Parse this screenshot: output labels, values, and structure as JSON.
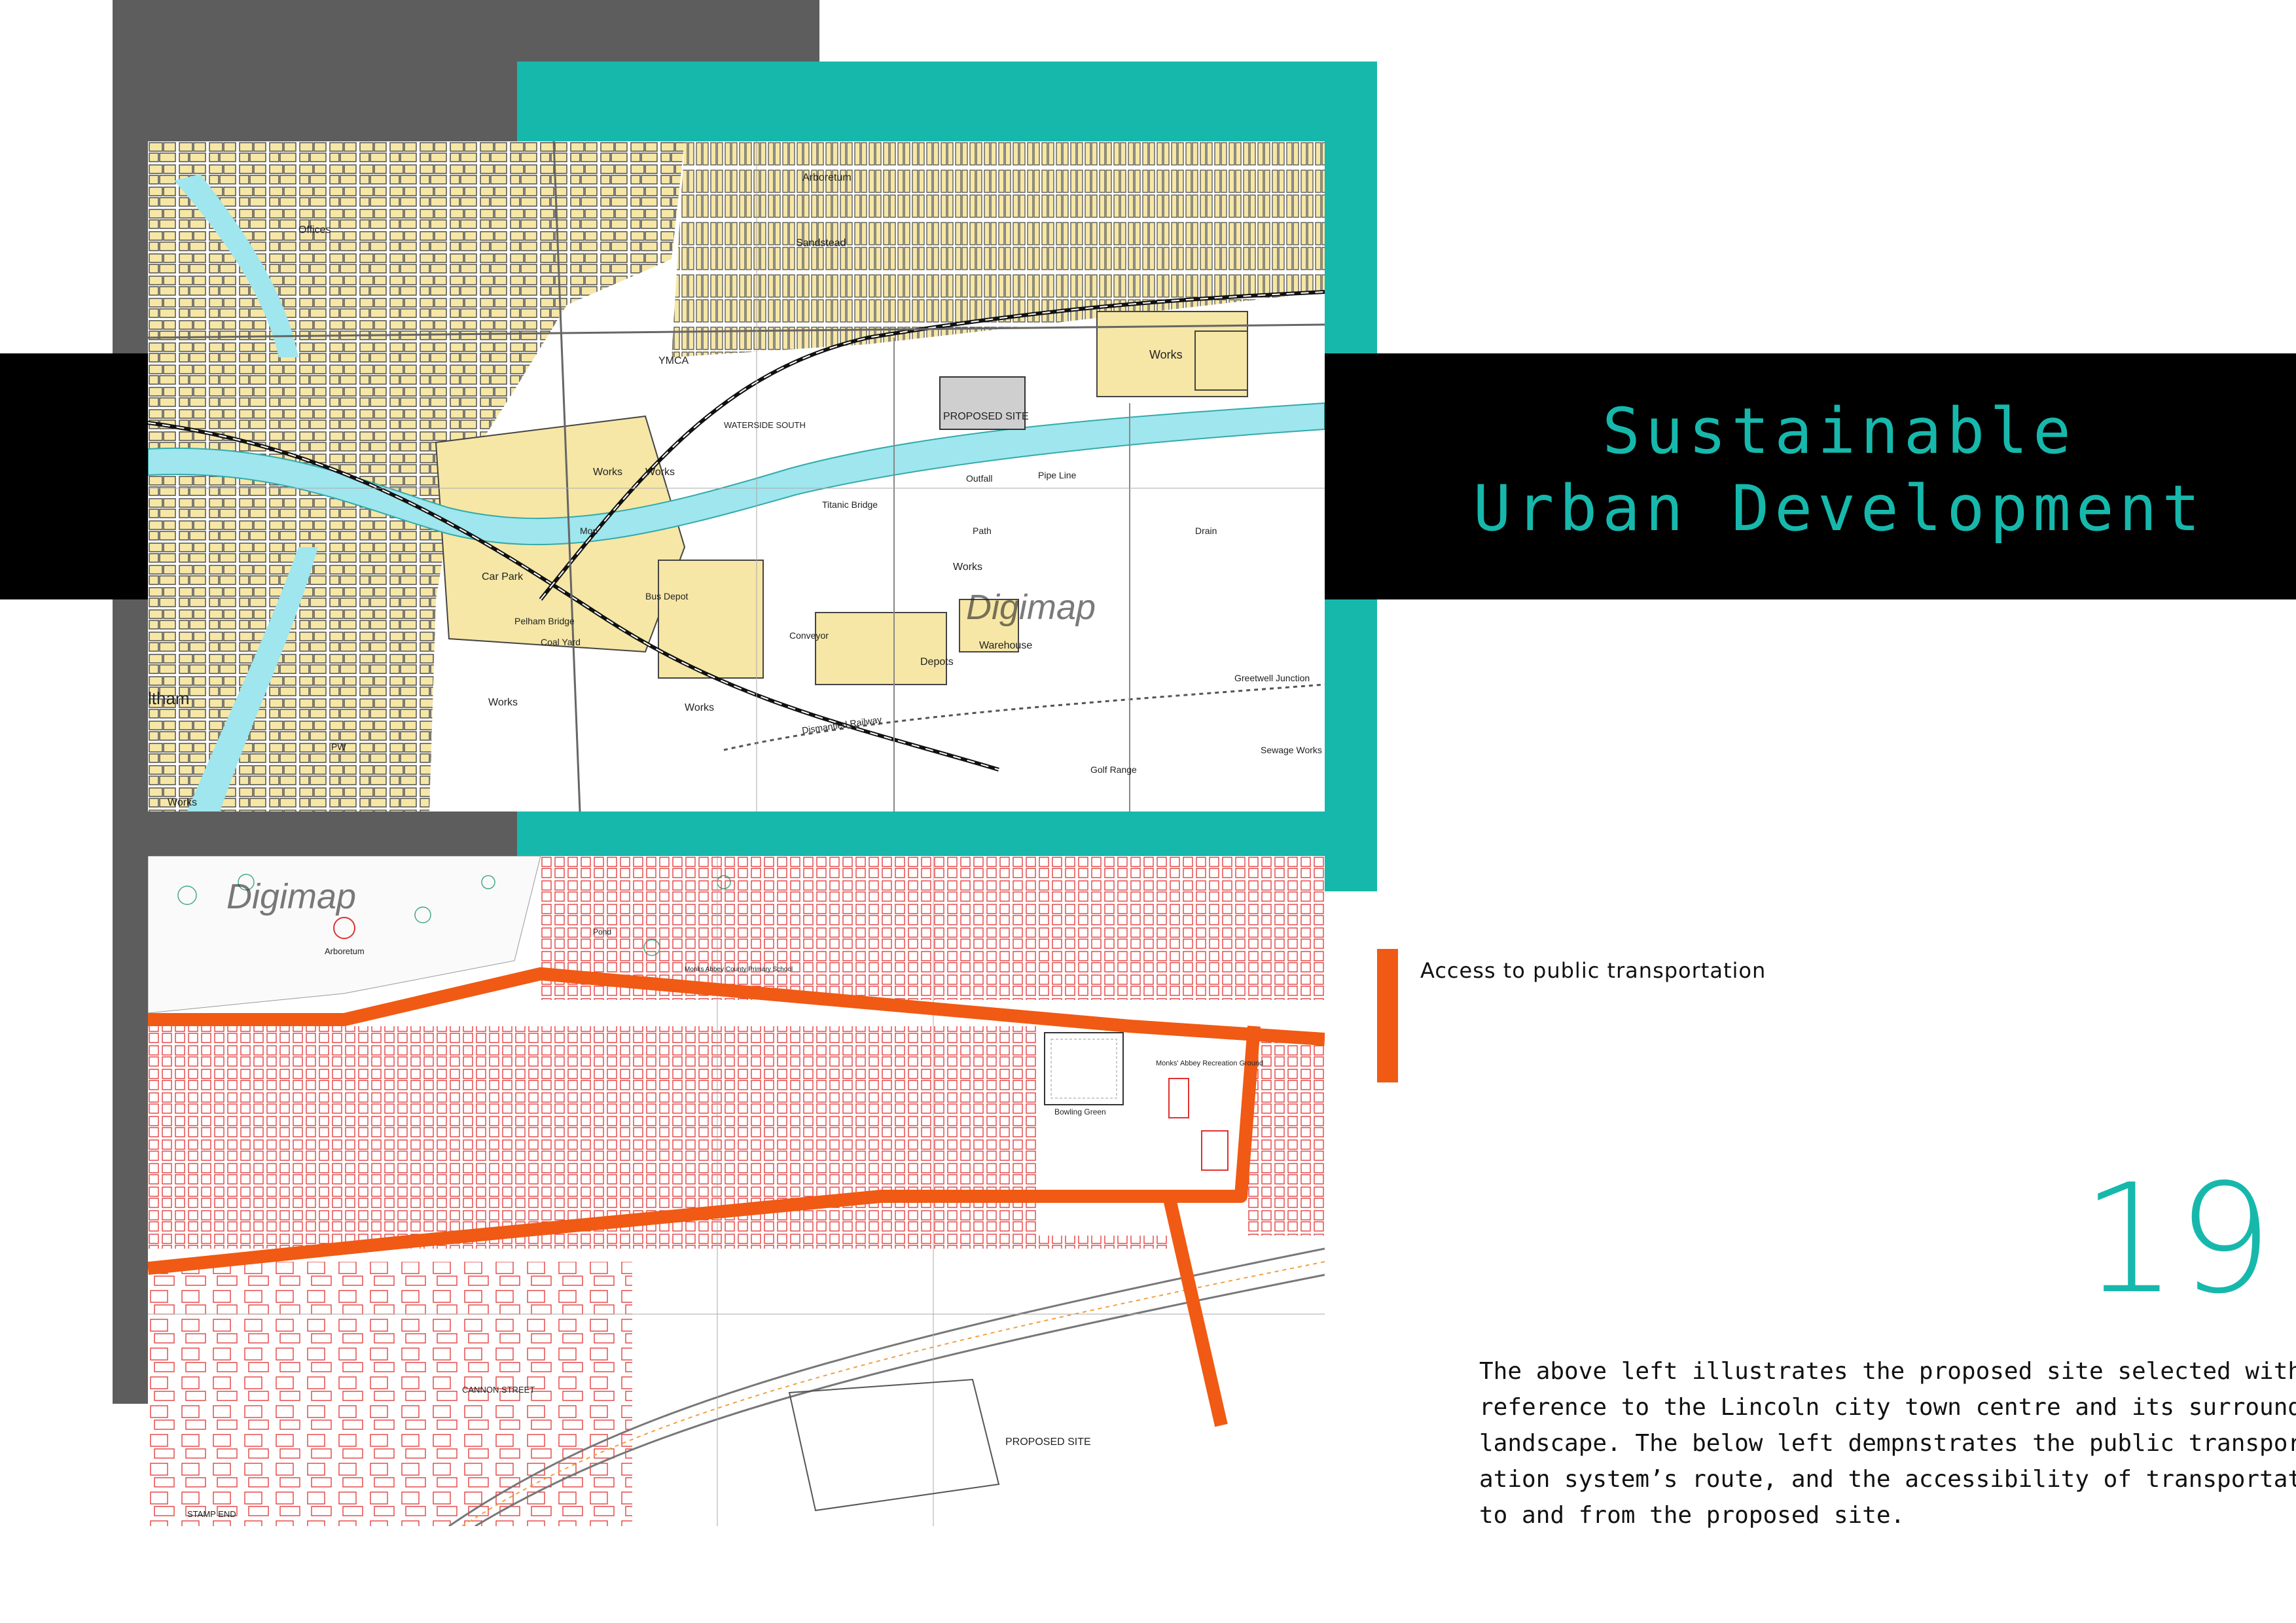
{
  "title": {
    "line1": "Sustainable",
    "line2": "Urban Development"
  },
  "colors": {
    "accent": "#17b8ac",
    "route": "#f05a14",
    "grey": "#5d5d5d",
    "band": "#000000",
    "building": "#f6e7a6",
    "water": "#9fe6ee"
  },
  "caption": "Access to public transportation",
  "page_number": "19",
  "description": {
    "lines": [
      "The above left illustrates the proposed site selected with",
      "reference to the Lincoln city town centre and its surrounding",
      "landscape. The below left dempnstrates the public transport-",
      "ation system’s route, and the accessibility of transportation",
      "to and from the proposed site."
    ]
  },
  "map_top": {
    "watermark": "Digimap",
    "labels": {
      "proposed_site": "PROPOSED SITE",
      "works": "Works",
      "car_park": "Car Park",
      "waterside_south": "WATERSIDE SOUTH",
      "ymca": "YMCA",
      "depots": "Depots",
      "warehouse": "Warehouse",
      "arboretum": "Arboretum",
      "sandstead": "Sandstead",
      "greetwell_junction": "Greetwell Junction",
      "sewage_works": "Sewage Works",
      "golf_range": "Golf Range",
      "dismantled_railway": "Dismantled Railway",
      "pelham_bridge": "Pelham Bridge",
      "coal_yard": "Coal Yard",
      "conveyor": "Conveyor",
      "titanic_bridge": "Titanic Bridge",
      "drain": "Drain",
      "ltham": "ltham",
      "offices": "Offices",
      "bus_depot": "Bus Depot",
      "pipe_line": "Pipe Line",
      "outfall": "Outfall",
      "path": "Path",
      "mon": "Mon",
      "pw": "PW"
    }
  },
  "map_bottom": {
    "watermark": "Digimap",
    "labels": {
      "proposed_site": "PROPOSED SITE",
      "bowling_green": "Bowling Green",
      "arboretum": "Arboretum",
      "cannon_street": "CANNON STREET",
      "stamp_end": "STAMP END",
      "monks_abbey": "Monks' Abbey Recreation Ground",
      "pond": "Pond",
      "school": "Monks Abbey County Primary School"
    }
  }
}
